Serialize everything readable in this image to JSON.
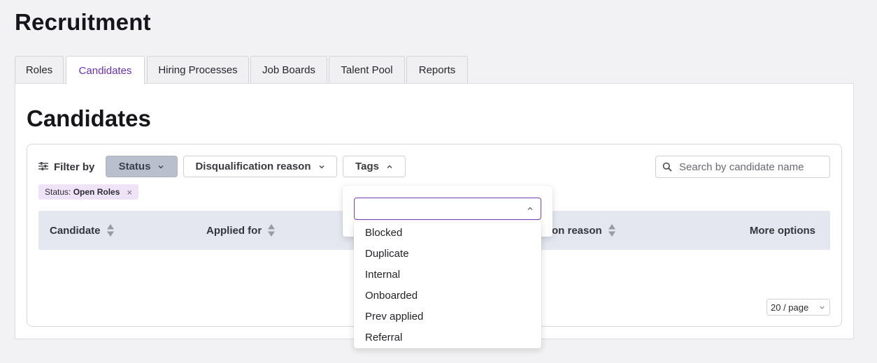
{
  "page": {
    "title": "Recruitment"
  },
  "tabs": [
    {
      "label": "Roles",
      "active": false
    },
    {
      "label": "Candidates",
      "active": true
    },
    {
      "label": "Hiring Processes",
      "active": false
    },
    {
      "label": "Job Boards",
      "active": false
    },
    {
      "label": "Talent Pool",
      "active": false
    },
    {
      "label": "Reports",
      "active": false
    }
  ],
  "section": {
    "title": "Candidates"
  },
  "filters": {
    "label": "Filter by",
    "status_label": "Status",
    "disqualification_label": "Disqualification reason",
    "tags_label": "Tags",
    "active_filter": {
      "key": "Status:",
      "value": "Open Roles",
      "remove": "×"
    }
  },
  "search": {
    "placeholder": "Search by candidate name",
    "value": ""
  },
  "table": {
    "columns": {
      "candidate": "Candidate",
      "applied_for": "Applied for",
      "disqualification_reason": "on reason",
      "more_options": "More options"
    }
  },
  "pagination": {
    "page_size": "20 / page"
  },
  "tags_dropdown": {
    "input_value": "",
    "options": [
      "Blocked",
      "Duplicate",
      "Internal",
      "Onboarded",
      "Prev applied",
      "Referral"
    ]
  },
  "colors": {
    "accent": "#6b2fb8",
    "status_filter_bg": "#b9bfcc",
    "chip_bg": "#efe4f7",
    "table_header_bg": "#e4e7ef"
  },
  "icons": {
    "filter": "sliders-icon",
    "search": "search-icon",
    "sort": "sort-icon",
    "chevron_down": "chevron-down-icon",
    "chevron_up": "chevron-up-icon",
    "close": "close-icon"
  }
}
